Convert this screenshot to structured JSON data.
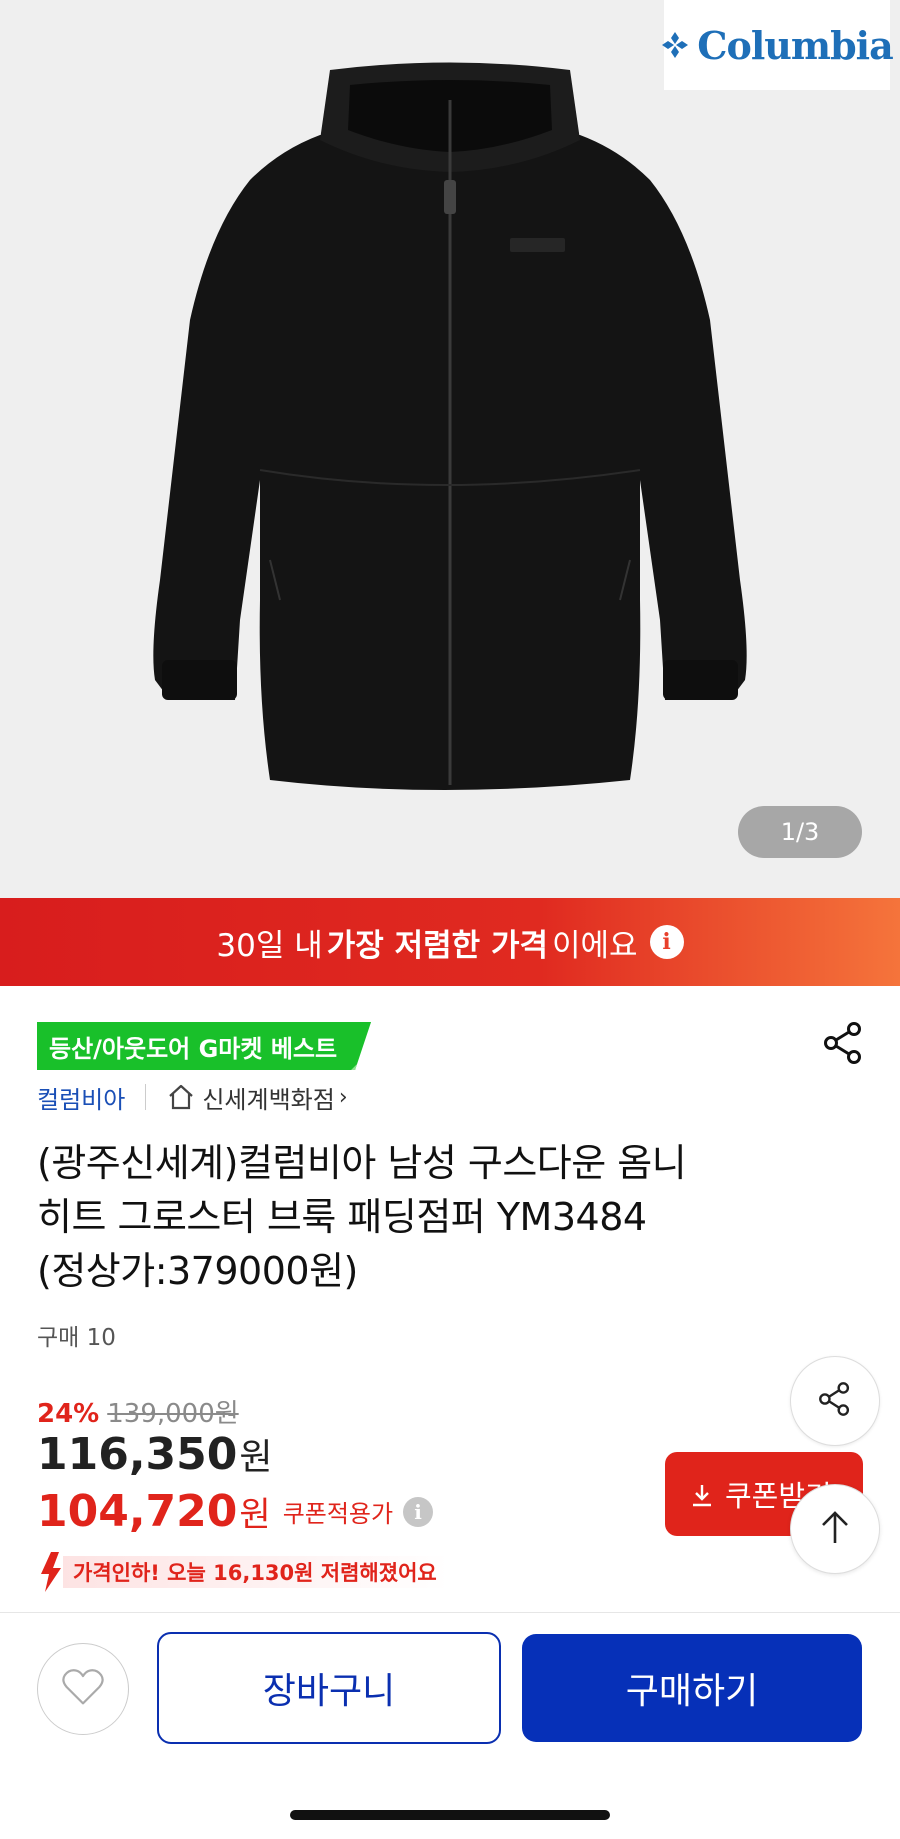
{
  "hero": {
    "brand_logo_text": "Columbia",
    "image_counter": "1/3"
  },
  "promo_banner": {
    "text_before": "30일 내 ",
    "text_bold": "가장 저렴한 가격",
    "text_after": "이에요",
    "info_icon": "info-icon"
  },
  "product": {
    "badge": "등산/아웃도어 G마켓 베스트",
    "brand": "컬럼비아",
    "store": "신세계백화점",
    "store_chevron": "›",
    "title": "(광주신세계)컬럼비아 남성 구스다운 옴니\n히트 그로스터 브룩 패딩점퍼  YM3484\n(정상가:379000원)",
    "sales_count": "구매 10"
  },
  "pricing": {
    "discount_rate": "24%",
    "original_price": "139,000원",
    "sale_price": "116,350",
    "sale_unit": "원",
    "coupon_price": "104,720",
    "coupon_unit": "원",
    "coupon_note": "쿠폰적용가",
    "coupon_button": "쿠폰받기",
    "price_drop": "가격인하! 오늘 16,130원 저렴해졌어요"
  },
  "bottom_bar": {
    "cart_label": "장바구니",
    "buy_label": "구매하기"
  },
  "colors": {
    "accent_red": "#e0241b",
    "brand_blue": "#0630b8",
    "badge_green": "#19c02a",
    "columbia_blue": "#1e6fb8"
  }
}
